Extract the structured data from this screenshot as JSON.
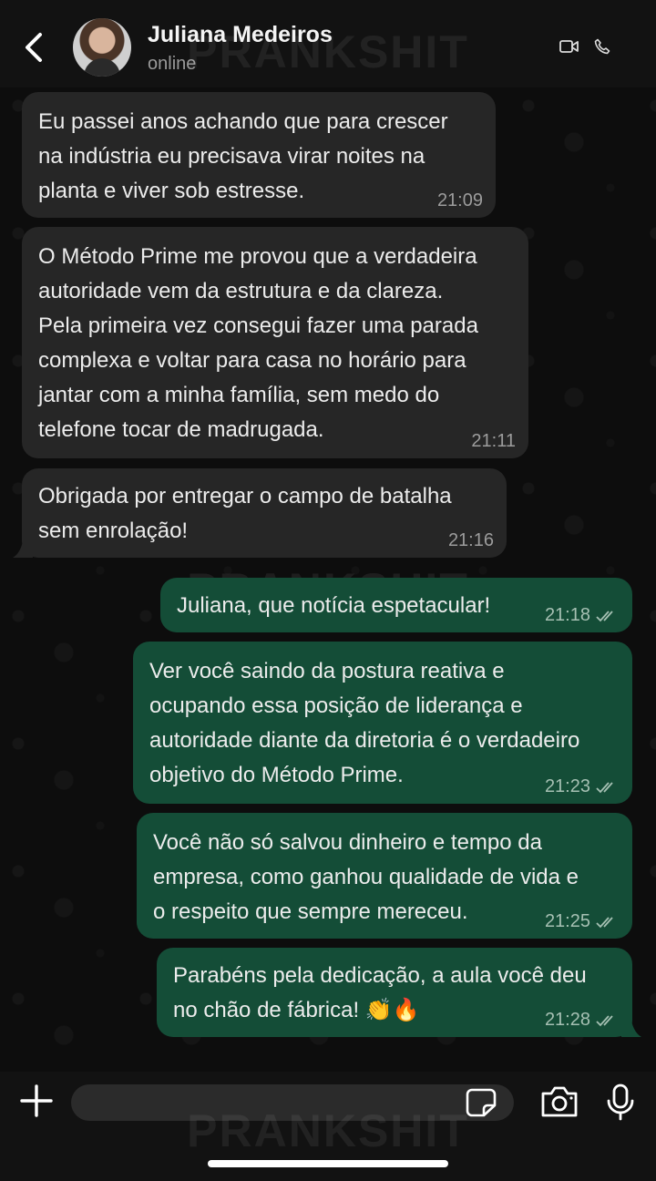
{
  "header": {
    "contact_name": "Juliana Medeiros",
    "status": "online"
  },
  "watermark": "PRANKSHIT",
  "messages": [
    {
      "direction": "in",
      "text": "Eu passei anos achando que para crescer\nna indústria eu precisava virar noites na\nplanta e viver sob estresse.",
      "time": "21:09"
    },
    {
      "direction": "in",
      "text": "O Método Prime me provou que a verdadeira\nautoridade vem da estrutura e da clareza.\nPela primeira vez consegui fazer uma parada\ncomplexa e voltar para casa no horário para\njantar com a minha família, sem medo do\ntelefone tocar de madrugada.",
      "time": "21:11"
    },
    {
      "direction": "in",
      "text": "Obrigada por entregar o campo de batalha\nsem enrolação!",
      "time": "21:16"
    },
    {
      "direction": "out",
      "text": "Juliana, que notícia espetacular!",
      "time": "21:18",
      "status": "read"
    },
    {
      "direction": "out",
      "text": "Ver você saindo da postura reativa e\nocupando essa posição de liderança e\nautoridade diante da diretoria é o verdadeiro\nobjetivo do Método Prime.",
      "time": "21:23",
      "status": "read"
    },
    {
      "direction": "out",
      "text": "Você não só salvou dinheiro e tempo da\nempresa, como ganhou qualidade de vida e\no respeito que sempre mereceu.",
      "time": "21:25",
      "status": "read"
    },
    {
      "direction": "out",
      "text": "Parabéns pela dedicação, a aula você deu\nno chão de fábrica! 👏🔥",
      "time": "21:28",
      "status": "read"
    }
  ],
  "composer": {
    "placeholder": ""
  },
  "icons": {
    "back": "chevron-left-icon",
    "video": "video-camera-icon",
    "call": "phone-icon",
    "attach": "plus-icon",
    "sticker": "sticker-icon",
    "camera": "camera-icon",
    "mic": "microphone-icon",
    "read_status": "double-check-icon"
  },
  "colors": {
    "incoming_bubble": "#262626",
    "outgoing_bubble": "#144d37",
    "header_bg": "#121212"
  }
}
